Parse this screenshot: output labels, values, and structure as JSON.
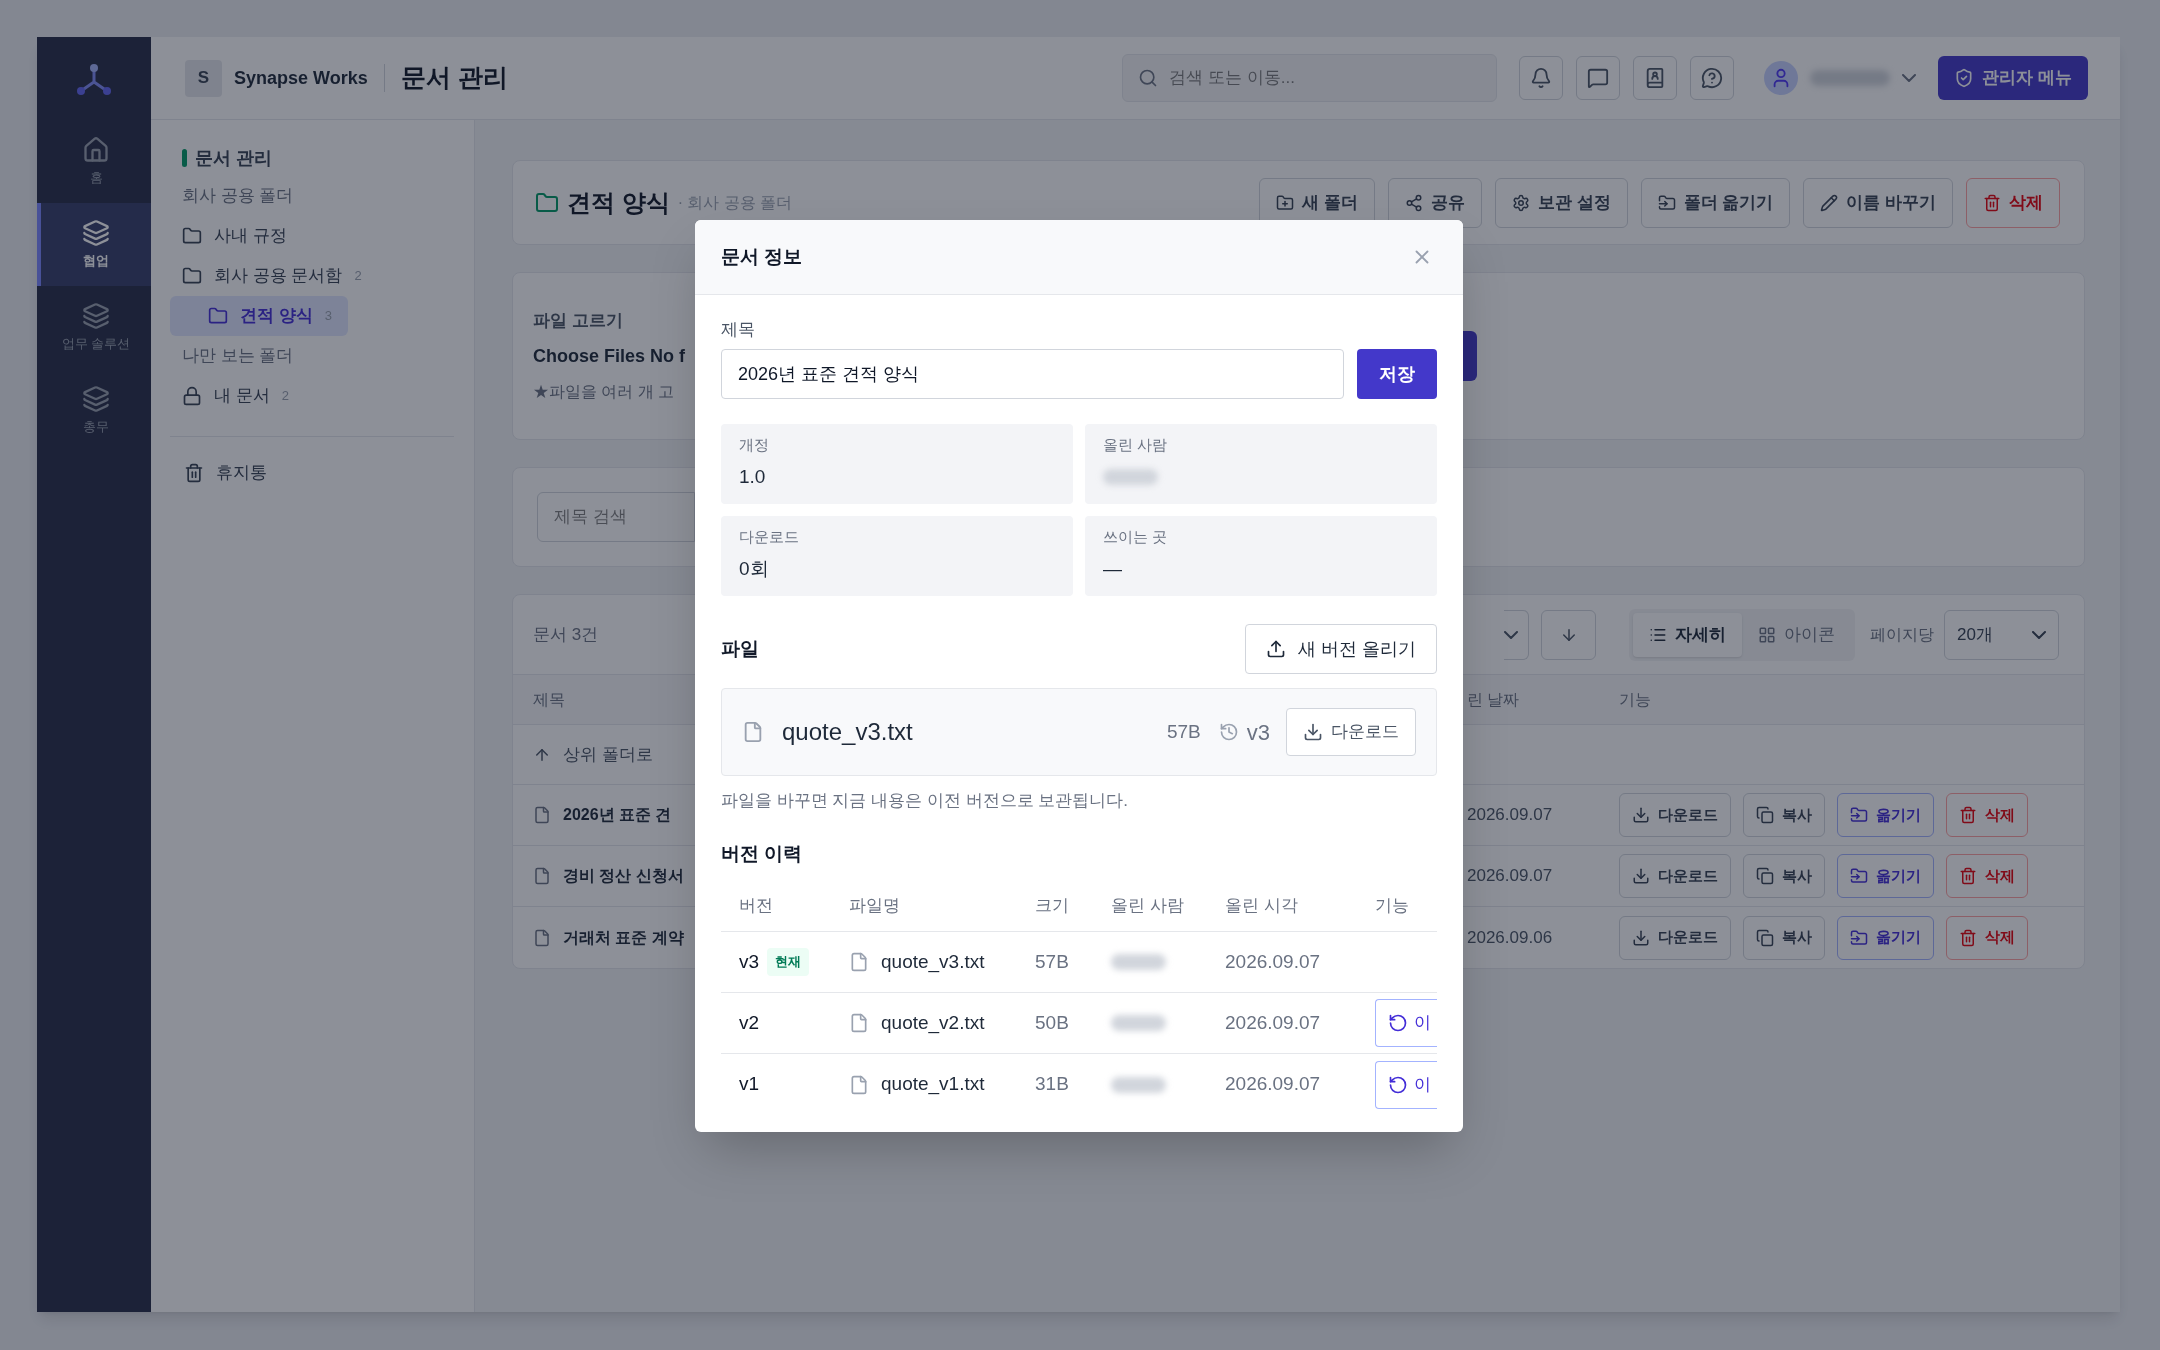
{
  "header": {
    "workspace_initial": "S",
    "workspace": "Synapse Works",
    "page_title": "문서 관리",
    "search": {
      "placeholder": "검색 또는 이동..."
    },
    "admin_button": "관리자 메뉴"
  },
  "rail": [
    {
      "label": "홈",
      "selected": false
    },
    {
      "label": "협업",
      "selected": true
    },
    {
      "label": "업무 솔루션",
      "selected": false
    },
    {
      "label": "총무",
      "selected": false
    }
  ],
  "nav": {
    "title": "문서 관리",
    "sections": [
      {
        "heading": "회사 공용 폴더",
        "items": [
          {
            "label": "사내 규정",
            "kind": "folder",
            "selected": false
          },
          {
            "label": "회사 공용 문서함",
            "kind": "folder",
            "count": "2",
            "selected": false,
            "children": [
              {
                "label": "견적 양식",
                "kind": "folder",
                "count": "3",
                "selected": true
              }
            ]
          }
        ]
      },
      {
        "heading": "나만 보는 폴더",
        "items": [
          {
            "label": "내 문서",
            "kind": "private",
            "count": "2",
            "selected": false
          }
        ]
      }
    ],
    "trash": "휴지통"
  },
  "folder_header": {
    "title": "견적 양식",
    "subtitle": "· 회사 공용 폴더",
    "actions": [
      {
        "label": "새 폴더",
        "kind": "default"
      },
      {
        "label": "공유",
        "kind": "default"
      },
      {
        "label": "보관 설정",
        "kind": "default"
      },
      {
        "label": "폴더 옮기기",
        "kind": "default"
      },
      {
        "label": "이름 바꾸기",
        "kind": "default"
      },
      {
        "label": "삭제",
        "kind": "danger"
      }
    ]
  },
  "upload": {
    "label": "파일 고르기",
    "file_input": "Choose Files No f",
    "hint": "★파일을 여러 개 고"
  },
  "filter": {
    "placeholder": "제목 검색"
  },
  "documents": {
    "count": "문서 3건",
    "views": [
      {
        "label": "자세히",
        "selected": true
      },
      {
        "label": "아이콘",
        "selected": false
      }
    ],
    "page_size_label": "페이지당",
    "page_size": "20개",
    "columns": [
      "제목",
      "린 날짜",
      "기능"
    ],
    "parent_row": "상위 폴더로",
    "rows": [
      {
        "title": "2026년 표준 견",
        "date": "2026.09.07",
        "actions": [
          {
            "label": "다운로드",
            "kind": "default"
          },
          {
            "label": "복사",
            "kind": "default"
          },
          {
            "label": "옮기기",
            "kind": "primary"
          },
          {
            "label": "삭제",
            "kind": "danger"
          }
        ]
      },
      {
        "title": "경비 정산 신청서",
        "date": "2026.09.07",
        "actions": [
          {
            "label": "다운로드",
            "kind": "default"
          },
          {
            "label": "복사",
            "kind": "default"
          },
          {
            "label": "옮기기",
            "kind": "primary"
          },
          {
            "label": "삭제",
            "kind": "danger"
          }
        ]
      },
      {
        "title": "거래처 표준 계약",
        "date": "2026.09.06",
        "actions": [
          {
            "label": "다운로드",
            "kind": "default"
          },
          {
            "label": "복사",
            "kind": "default"
          },
          {
            "label": "옮기기",
            "kind": "primary"
          },
          {
            "label": "삭제",
            "kind": "danger"
          }
        ]
      }
    ]
  },
  "modal": {
    "title": "문서 정보",
    "title_field": {
      "label": "제목",
      "value": "2026년 표준 견적 양식"
    },
    "save_button": "저장",
    "info": [
      {
        "label": "개정",
        "value": "1.0"
      },
      {
        "label": "올린 사람"
      },
      {
        "label": "다운로드",
        "value": "0회"
      },
      {
        "label": "쓰이는 곳",
        "value": "—"
      }
    ],
    "file": {
      "heading": "파일",
      "upload_button": "새 버전 올리기",
      "name": "quote_v3.txt",
      "size": "57B",
      "version": "v3",
      "download_button": "다운로드",
      "note": "파일을 바꾸면 지금 내용은 이전 버전으로 보관됩니다."
    },
    "history": {
      "heading": "버전 이력",
      "columns": [
        "버전",
        "파일명",
        "크기",
        "올린 사람",
        "올린 시각",
        "기능"
      ],
      "rows": [
        {
          "version": "v3",
          "badge": "현재",
          "file": "quote_v3.txt",
          "size": "57B",
          "date": "2026.09.07"
        },
        {
          "version": "v2",
          "file": "quote_v2.txt",
          "size": "50B",
          "date": "2026.09.07",
          "action": "이"
        },
        {
          "version": "v1",
          "file": "quote_v1.txt",
          "size": "31B",
          "date": "2026.09.07",
          "action": "이"
        }
      ]
    }
  }
}
